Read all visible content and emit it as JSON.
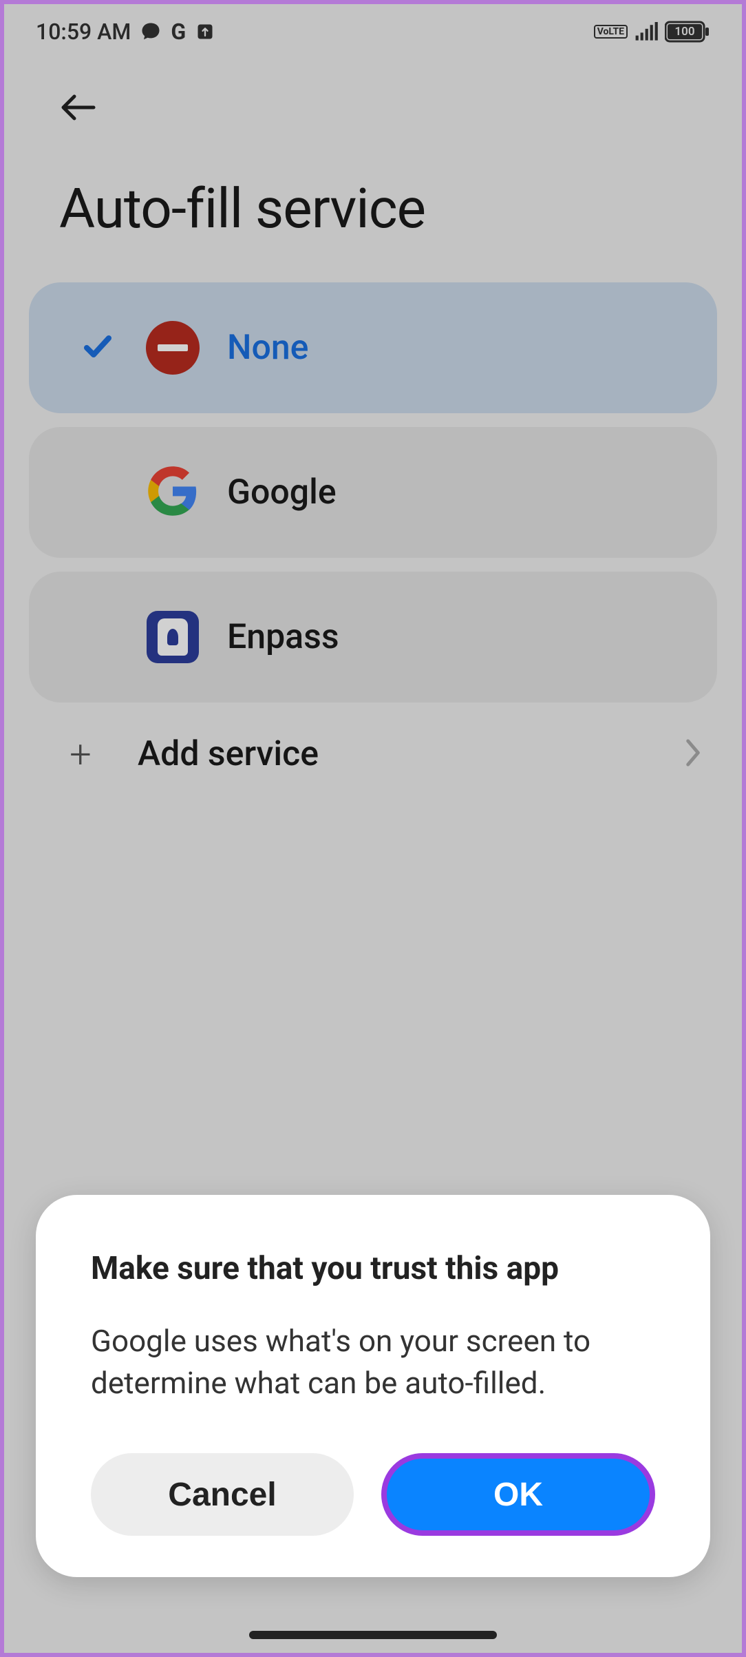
{
  "statusbar": {
    "time": "10:59 AM",
    "volte_label": "VoLTE",
    "battery_pct": "100"
  },
  "page": {
    "title": "Auto-fill service",
    "add_service_label": "Add service"
  },
  "options": [
    {
      "id": "none",
      "label": "None",
      "selected": true
    },
    {
      "id": "google",
      "label": "Google",
      "selected": false
    },
    {
      "id": "enpass",
      "label": "Enpass",
      "selected": false
    }
  ],
  "dialog": {
    "title": "Make sure that you trust this app",
    "body": "Google uses what's on your screen to determine what can be auto-filled.",
    "cancel": "Cancel",
    "ok": "OK"
  }
}
